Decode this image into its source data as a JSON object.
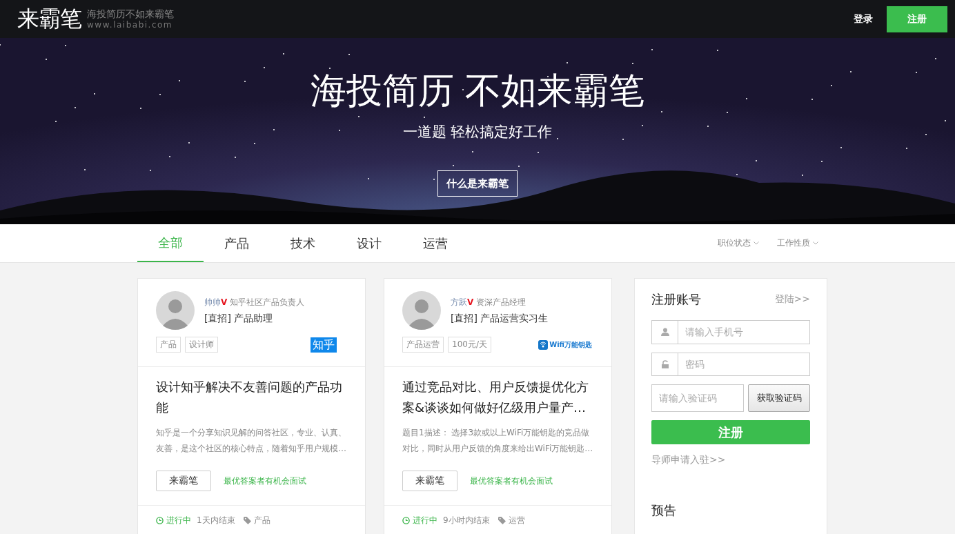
{
  "header": {
    "logo": "来霸笔",
    "tagline": "海投简历不如来霸笔",
    "url": "www.laibabi.com",
    "login": "登录",
    "register": "注册"
  },
  "hero": {
    "kind": "picture",
    "title": "海投简历 不如来霸笔",
    "subtitle": "一道题 轻松搞定好工作",
    "button": "什么是来霸笔"
  },
  "tabs": [
    {
      "label": "全部",
      "selected": true
    },
    {
      "label": "产品",
      "selected": false
    },
    {
      "label": "技术",
      "selected": false
    },
    {
      "label": "设计",
      "selected": false
    },
    {
      "label": "运营",
      "selected": false
    }
  ],
  "filters": [
    "职位状态",
    "工作性质"
  ],
  "cards": [
    {
      "mentor": "帅帅",
      "verified": "V",
      "mentor_title": "知乎社区产品负责人",
      "job": "[直招] 产品助理",
      "tags": [
        "产品",
        "设计师"
      ],
      "company_logo": {
        "kind": "text",
        "text": "知乎"
      },
      "question": "设计知乎解决不友善问题的产品功能",
      "description": "知乎是一个分享知识见解的问答社区，专业、认真、友善，是这个社区的核心特点，随着知乎用户规模…",
      "action": "来霸笔",
      "hint": "最优答案者有机会面试",
      "status": "进行中",
      "deadline": "1天内结束",
      "category": "产品"
    },
    {
      "mentor": "方跃",
      "verified": "V",
      "mentor_title": "资深产品经理",
      "job": "[直招] 产品运营实习生",
      "tags": [
        "产品运营",
        "100元/天"
      ],
      "company_logo": {
        "kind": "icon",
        "text": "Wifi万能钥匙"
      },
      "question": "通过竞品对比、用户反馈提优化方案&谈谈如何做好亿级用户量产…",
      "description": "题目1描述： 选择3款或以上WiFi万能钥匙的竞品做对比，同时从用户反馈的角度来给出WiFi万能钥匙…",
      "action": "来霸笔",
      "hint": "最优答案者有机会面试",
      "status": "进行中",
      "deadline": "9小时内结束",
      "category": "运营"
    }
  ],
  "signup": {
    "title": "注册账号",
    "login_link": "登陆>>",
    "phone_placeholder": "请输入手机号",
    "password_placeholder": "密码",
    "code_placeholder": "请输入验证码",
    "code_button": "获取验证码",
    "submit": "注册",
    "mentor_link": "导师申请入驻>>"
  },
  "preview": {
    "title": "预告"
  }
}
